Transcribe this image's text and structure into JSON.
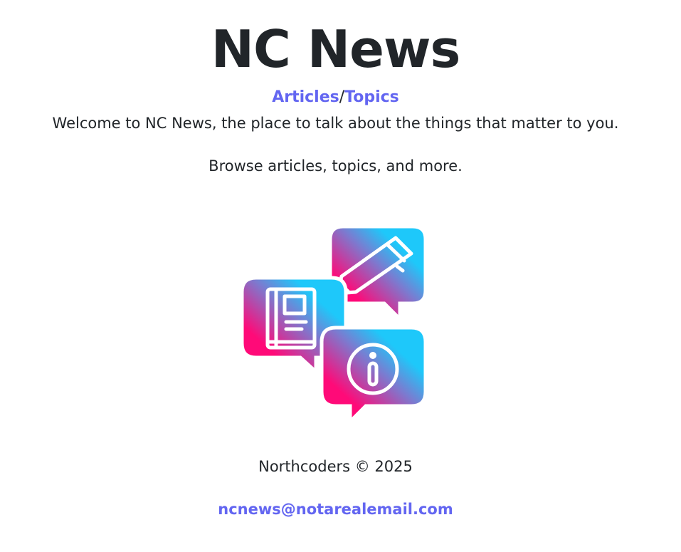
{
  "header": {
    "title": "NC News"
  },
  "nav": {
    "articles_label": "Articles",
    "separator": "/",
    "topics_label": "Topics"
  },
  "main": {
    "welcome_text": "Welcome to NC News, the place to talk about the things that matter to you.",
    "browse_text": "Browse articles, topics, and more.",
    "logo_icons": [
      "book-icon",
      "pencil-icon",
      "info-icon"
    ]
  },
  "footer": {
    "copyright": "Northcoders © 2025",
    "email": "ncnews@notarealemail.com"
  },
  "colors": {
    "link": "#6366f1",
    "text": "#212529",
    "gradient_pink": "#ff0a78",
    "gradient_blue": "#1ec8fa"
  }
}
